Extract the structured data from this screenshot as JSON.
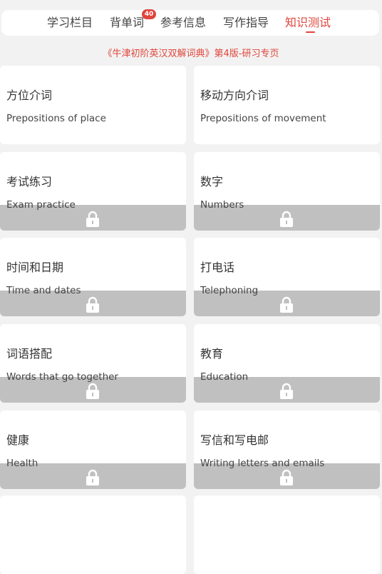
{
  "tabs": [
    {
      "label": "学习栏目"
    },
    {
      "label": "背单词",
      "badge": "40"
    },
    {
      "label": "参考信息"
    },
    {
      "label": "写作指导"
    },
    {
      "label": "知识测试",
      "active": true
    }
  ],
  "subtitle": "《牛津初阶英汉双解词典》第4版-研习专页",
  "cards": [
    {
      "cn": "方位介词",
      "en": "Prepositions of place",
      "locked": false
    },
    {
      "cn": "移动方向介词",
      "en": "Prepositions of movement",
      "locked": false
    },
    {
      "cn": "考试练习",
      "en": "Exam practice",
      "locked": true
    },
    {
      "cn": "数字",
      "en": "Numbers",
      "locked": true
    },
    {
      "cn": "时间和日期",
      "en": "Time and dates",
      "locked": true
    },
    {
      "cn": "打电话",
      "en": "Telephoning",
      "locked": true
    },
    {
      "cn": "词语搭配",
      "en": "Words that go together",
      "locked": true
    },
    {
      "cn": "教育",
      "en": "Education",
      "locked": true
    },
    {
      "cn": "健康",
      "en": "Health",
      "locked": true
    },
    {
      "cn": "写信和写电邮",
      "en": "Writing letters and emails",
      "locked": true
    }
  ],
  "icons": {
    "lock": "lock-icon"
  },
  "colors": {
    "accent": "#e0453c",
    "lock_overlay": "#c0c0c0"
  }
}
